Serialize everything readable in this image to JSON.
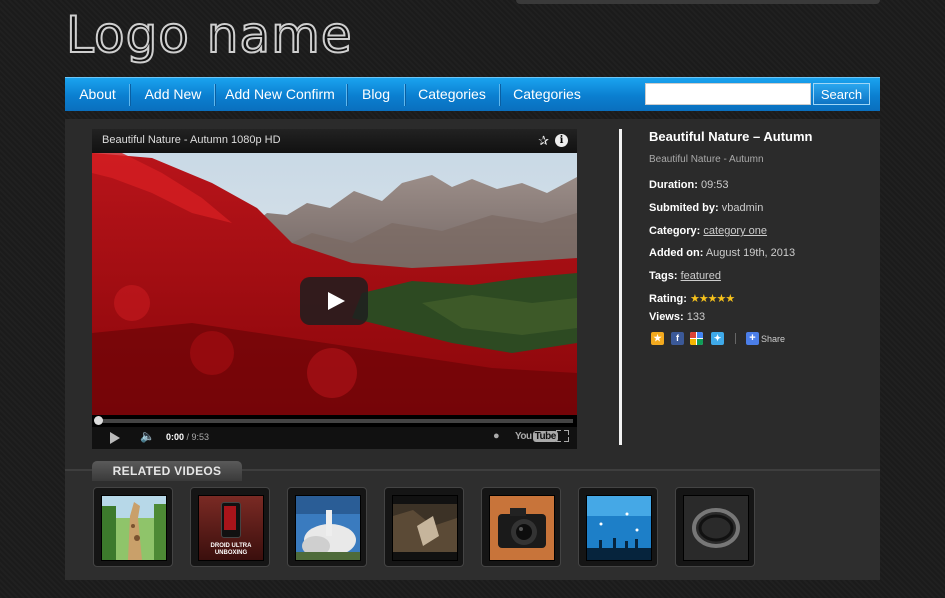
{
  "header": {
    "logo_text": "Logo name"
  },
  "nav": {
    "items": [
      {
        "label": "About"
      },
      {
        "label": "Add New"
      },
      {
        "label": "Add New Confirm"
      },
      {
        "label": "Blog"
      },
      {
        "label": "Categories"
      },
      {
        "label": "Categories"
      }
    ],
    "search_value": "",
    "search_button": "Search"
  },
  "player": {
    "title": "Beautiful Nature - Autumn 1080p HD",
    "current_time": "0:00",
    "duration": "9:53",
    "progress_fraction": 0.0,
    "youtube_left": "You",
    "youtube_right": "Tube"
  },
  "info": {
    "title": "Beautiful Nature – Autumn",
    "subtitle": "Beautiful Nature - Autumn",
    "duration_label": "Duration:",
    "duration_value": "09:53",
    "submitted_label": "Submited by:",
    "submitted_value": "vbadmin",
    "category_label": "Category:",
    "category_value": "category one",
    "added_label": "Added on:",
    "added_value": "August 19th, 2013",
    "tags_label": "Tags:",
    "tags_value": "featured",
    "rating_label": "Rating:",
    "rating_stars": 5,
    "views_label": "Views:",
    "views_value": "133",
    "share_label": "Share"
  },
  "related": {
    "heading": "RELATED VIDEOS",
    "thumbs": [
      {
        "name": "giraffe",
        "label": ""
      },
      {
        "name": "droid-ultra",
        "label": "DROID ULTRA\nUNBOXING"
      },
      {
        "name": "rocket-launch",
        "label": ""
      },
      {
        "name": "dark-scene",
        "label": ""
      },
      {
        "name": "camera",
        "label": ""
      },
      {
        "name": "aquarium",
        "label": ""
      },
      {
        "name": "wristband",
        "label": ""
      }
    ]
  },
  "colors": {
    "nav_blue": "#0b7fd0",
    "star_gold": "#f6c21c",
    "background": "#1c1c1c"
  }
}
